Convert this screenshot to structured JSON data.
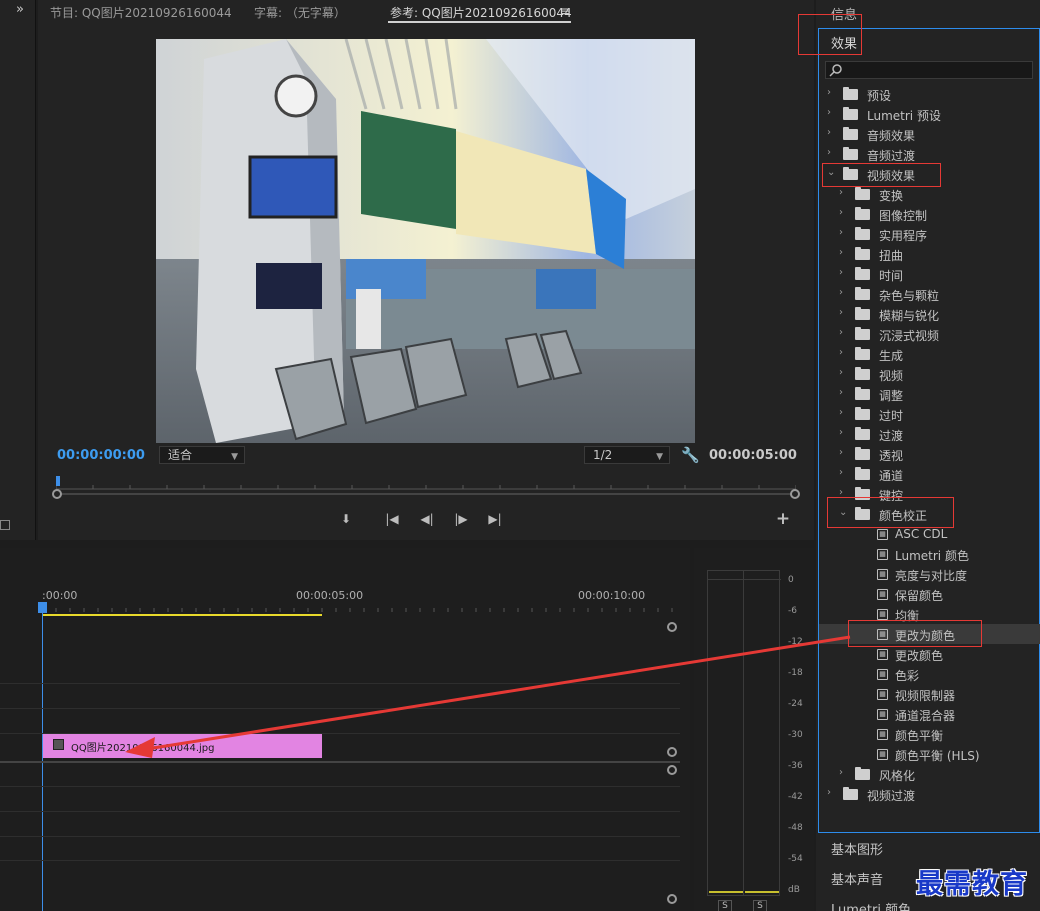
{
  "monitor": {
    "tabs": [
      {
        "label": "节目: QQ图片20210926160044"
      },
      {
        "label": "字幕: （无字幕）"
      },
      {
        "label": "参考: QQ图片20210926160044"
      }
    ],
    "tab_menu_glyph": "≡",
    "timecode_in": "00:00:00:00",
    "timecode_out": "00:00:05:00",
    "zoom_select": "适合",
    "resolution_select": "1/2",
    "wrench_icon": "wrench-icon",
    "transport": [
      "marker-in-icon",
      "go-to-in-icon",
      "step-back-icon",
      "step-forward-icon",
      "go-to-out-icon"
    ],
    "add_button": "+"
  },
  "effects_panel": {
    "header_info": "信息",
    "header_effects": "效果",
    "search_placeholder": "",
    "items": [
      {
        "label": "预设",
        "depth": 0,
        "state": "collapsed",
        "kind": "preset-folder"
      },
      {
        "label": "Lumetri 预设",
        "depth": 0,
        "state": "collapsed",
        "kind": "preset-folder"
      },
      {
        "label": "音频效果",
        "depth": 0,
        "state": "collapsed",
        "kind": "folder"
      },
      {
        "label": "音频过渡",
        "depth": 0,
        "state": "collapsed",
        "kind": "folder"
      },
      {
        "label": "视频效果",
        "depth": 0,
        "state": "expanded",
        "kind": "folder"
      },
      {
        "label": "变换",
        "depth": 1,
        "state": "collapsed",
        "kind": "folder"
      },
      {
        "label": "图像控制",
        "depth": 1,
        "state": "collapsed",
        "kind": "folder"
      },
      {
        "label": "实用程序",
        "depth": 1,
        "state": "collapsed",
        "kind": "folder"
      },
      {
        "label": "扭曲",
        "depth": 1,
        "state": "collapsed",
        "kind": "folder"
      },
      {
        "label": "时间",
        "depth": 1,
        "state": "collapsed",
        "kind": "folder"
      },
      {
        "label": "杂色与颗粒",
        "depth": 1,
        "state": "collapsed",
        "kind": "folder"
      },
      {
        "label": "模糊与锐化",
        "depth": 1,
        "state": "collapsed",
        "kind": "folder"
      },
      {
        "label": "沉浸式视频",
        "depth": 1,
        "state": "collapsed",
        "kind": "folder"
      },
      {
        "label": "生成",
        "depth": 1,
        "state": "collapsed",
        "kind": "folder"
      },
      {
        "label": "视频",
        "depth": 1,
        "state": "collapsed",
        "kind": "folder"
      },
      {
        "label": "调整",
        "depth": 1,
        "state": "collapsed",
        "kind": "folder"
      },
      {
        "label": "过时",
        "depth": 1,
        "state": "collapsed",
        "kind": "folder"
      },
      {
        "label": "过渡",
        "depth": 1,
        "state": "collapsed",
        "kind": "folder"
      },
      {
        "label": "透视",
        "depth": 1,
        "state": "collapsed",
        "kind": "folder"
      },
      {
        "label": "通道",
        "depth": 1,
        "state": "collapsed",
        "kind": "folder"
      },
      {
        "label": "键控",
        "depth": 1,
        "state": "collapsed",
        "kind": "folder"
      },
      {
        "label": "颜色校正",
        "depth": 1,
        "state": "expanded",
        "kind": "folder"
      },
      {
        "label": "ASC CDL",
        "depth": 2,
        "kind": "effect"
      },
      {
        "label": "Lumetri 颜色",
        "depth": 2,
        "kind": "effect"
      },
      {
        "label": "亮度与对比度",
        "depth": 2,
        "kind": "effect"
      },
      {
        "label": "保留颜色",
        "depth": 2,
        "kind": "effect"
      },
      {
        "label": "均衡",
        "depth": 2,
        "kind": "effect"
      },
      {
        "label": "更改为颜色",
        "depth": 2,
        "kind": "effect",
        "selected": true
      },
      {
        "label": "更改颜色",
        "depth": 2,
        "kind": "effect"
      },
      {
        "label": "色彩",
        "depth": 2,
        "kind": "effect"
      },
      {
        "label": "视频限制器",
        "depth": 2,
        "kind": "effect"
      },
      {
        "label": "通道混合器",
        "depth": 2,
        "kind": "effect"
      },
      {
        "label": "颜色平衡",
        "depth": 2,
        "kind": "effect"
      },
      {
        "label": "颜色平衡 (HLS)",
        "depth": 2,
        "kind": "effect"
      },
      {
        "label": "风格化",
        "depth": 1,
        "state": "collapsed",
        "kind": "folder"
      },
      {
        "label": "视频过渡",
        "depth": 0,
        "state": "collapsed",
        "kind": "folder"
      }
    ],
    "footer_panels": [
      "基本图形",
      "基本声音",
      "Lumetri 颜色"
    ]
  },
  "timeline": {
    "ruler_labels": [
      ":00:00",
      "00:00:05:00",
      "00:00:10:00"
    ],
    "clip_label": "QQ图片20210926160044.jpg"
  },
  "audio_meter": {
    "db_labels": [
      "0",
      "-6",
      "-12",
      "-18",
      "-24",
      "-30",
      "-36",
      "-42",
      "-48",
      "-54",
      "dB"
    ],
    "solo_buttons": [
      "S",
      "S"
    ]
  },
  "watermark": "最需教育",
  "colors": {
    "accent_blue": "#2d8ceb",
    "highlight_red": "#e53935",
    "clip_pink": "#e284e2",
    "workarea_yellow": "#e8d92b",
    "playhead_blue": "#3d8ee8",
    "timecode_blue": "#3d9cf0"
  }
}
